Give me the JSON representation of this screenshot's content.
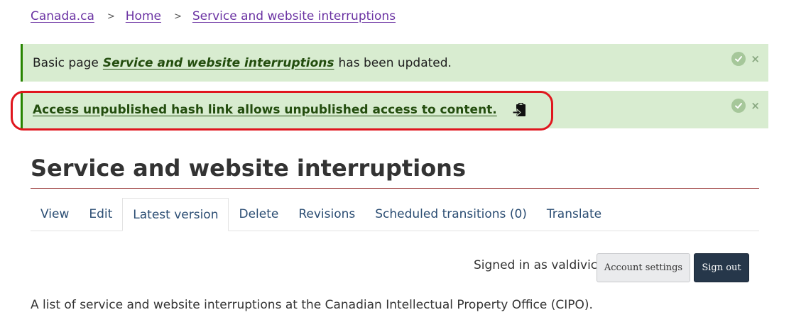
{
  "breadcrumb": {
    "items": [
      {
        "label": "Canada.ca"
      },
      {
        "label": "Home"
      },
      {
        "label": "Service and website interruptions"
      }
    ],
    "separator": ">"
  },
  "messages": {
    "status1": {
      "prefix": "Basic page",
      "link": "Service and website interruptions",
      "suffix": "has been updated."
    },
    "status2": {
      "link": "Access unpublished hash link allows unpublished access to content."
    },
    "close_glyph": "×",
    "check_icon": "check-circle-icon",
    "copy_icon": "clipboard-icon"
  },
  "page": {
    "title": "Service and website interruptions",
    "intro": "A list of service and website interruptions at the Canadian Intellectual Property Office (CIPO)."
  },
  "tabs": [
    {
      "label": "View",
      "active": false
    },
    {
      "label": "Edit",
      "active": false
    },
    {
      "label": "Latest version",
      "active": true
    },
    {
      "label": "Delete",
      "active": false
    },
    {
      "label": "Revisions",
      "active": false
    },
    {
      "label": "Scheduled transitions (0)",
      "active": false
    },
    {
      "label": "Translate",
      "active": false
    }
  ],
  "account": {
    "signed_in_text": "Signed in as valdivic",
    "settings_label": "Account settings",
    "signout_label": "Sign out"
  },
  "colors": {
    "link": "#6b33a3",
    "message_bg": "#d8ecd0",
    "message_border": "#278400",
    "highlight": "#e0161e",
    "signout_bg": "#26374a"
  }
}
